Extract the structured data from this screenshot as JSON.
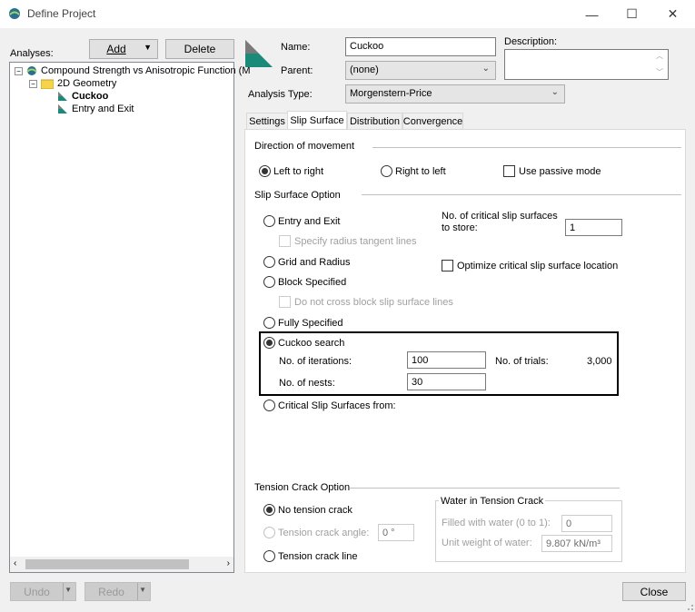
{
  "window": {
    "title": "Define Project",
    "minimize": "—",
    "maximize": "☐",
    "close": "✕"
  },
  "left": {
    "analyses_label": "Analyses:",
    "add_label": "Add",
    "delete_label": "Delete",
    "tree": [
      {
        "label": "Compound Strength vs Anisotropic Function (M",
        "expander": "−"
      },
      {
        "label": "2D Geometry",
        "expander": "−"
      },
      {
        "label": "Cuckoo"
      },
      {
        "label": "Entry and Exit"
      }
    ],
    "undo_label": "Undo",
    "redo_label": "Redo"
  },
  "header": {
    "name_label": "Name:",
    "name_value": "Cuckoo",
    "parent_label": "Parent:",
    "parent_value": "(none)",
    "analysis_type_label": "Analysis Type:",
    "analysis_type_value": "Morgenstern-Price",
    "description_label": "Description:",
    "description_value": ""
  },
  "tabs": [
    "Settings",
    "Slip Surface",
    "Distribution",
    "Convergence"
  ],
  "slip": {
    "direction_title": "Direction of movement",
    "left_to_right": "Left to right",
    "right_to_left": "Right to left",
    "passive_mode": "Use passive mode",
    "option_title": "Slip Surface Option",
    "entry_exit": "Entry and Exit",
    "radius_tangent": "Specify radius tangent lines",
    "grid_radius": "Grid and Radius",
    "block_specified": "Block Specified",
    "no_cross_block": "Do not cross block slip surface lines",
    "fully_specified": "Fully Specified",
    "cuckoo_search": "Cuckoo search",
    "iterations_label": "No. of iterations:",
    "iterations_value": "100",
    "nests_label": "No. of nests:",
    "nests_value": "30",
    "trials_label": "No. of trials:",
    "trials_value": "3,000",
    "critical_from": "Critical Slip Surfaces from:",
    "critical_store_label_1": "No. of critical slip surfaces",
    "critical_store_label_2": "to store:",
    "critical_store_value": "1",
    "optimize": "Optimize critical slip surface location"
  },
  "tension": {
    "title": "Tension Crack Option",
    "no_crack": "No tension crack",
    "crack_angle": "Tension crack angle:",
    "crack_angle_value": "0 °",
    "crack_line": "Tension crack line",
    "water_title": "Water in Tension Crack",
    "filled_label": "Filled with water (0 to 1):",
    "filled_value": "0",
    "unit_weight_label": "Unit weight of water:",
    "unit_weight_value": "9.807 kN/m³"
  },
  "footer": {
    "close_label": "Close"
  },
  "colors": {
    "accent": "#1a8a7a",
    "folder": "#f5d44b"
  }
}
